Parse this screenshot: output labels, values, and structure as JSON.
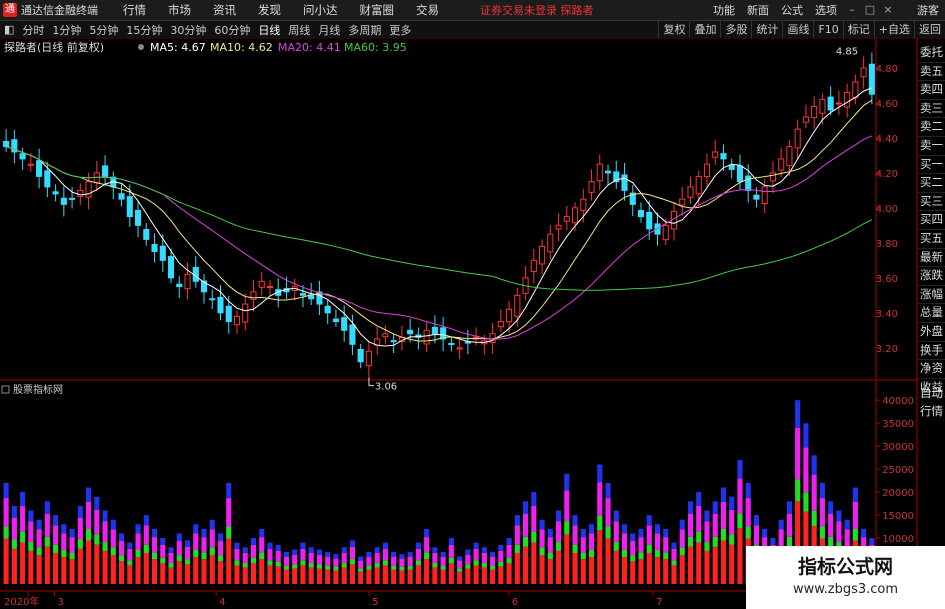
{
  "app": {
    "title": "通达信金融终端",
    "logo_char": "通"
  },
  "menu": [
    "行情",
    "市场",
    "资讯",
    "发现",
    "问小达",
    "财富圈",
    "交易"
  ],
  "notice": "证券交易未登录  探路者",
  "right_menu": [
    "功能",
    "新面",
    "公式",
    "选项",
    "游客"
  ],
  "toolbar": [
    "分时",
    "1分钟",
    "5分钟",
    "15分钟",
    "30分钟",
    "60分钟",
    "日线",
    "周线",
    "月线",
    "多周期",
    "更多"
  ],
  "toolbar_active": "日线",
  "toolbar_right": [
    "复权",
    "叠加",
    "多股",
    "统计",
    "画线",
    "F10",
    "标记",
    "+自选",
    "返回"
  ],
  "side_tabs": [
    "委托",
    "卖五",
    "卖四",
    "卖三",
    "卖二",
    "卖一",
    "买一",
    "买二",
    "买三",
    "买四",
    "买五",
    "最新",
    "涨跌",
    "涨幅",
    "总量",
    "外盘",
    "换手",
    "净资",
    "收益"
  ],
  "side_tabs2": [
    "自动",
    "行情"
  ],
  "main_legend": {
    "name": "探路者(日线 前复权)",
    "ma5": "MA5: 4.67",
    "ma10": "MA10: 4.62",
    "ma20": "MA20: 4.41",
    "ma60": "MA60: 3.95",
    "color_ma5": "#ffffff",
    "color_ma10": "#f0e68c",
    "color_ma20": "#dd44dd",
    "color_ma60": "#44cc44"
  },
  "volume_legend": "股票指标网",
  "annotations": {
    "high": "4.85",
    "low": "3.06"
  },
  "date_labels": [
    "2020年",
    "3",
    "4",
    "5",
    "6",
    "7"
  ],
  "watermark": {
    "title": "指标公式网",
    "url": "www.zbgs3.com"
  },
  "colors": {
    "up": "#ff3333",
    "down": "#33ddff",
    "axis": "#b00000",
    "ma5": "#ffffff",
    "ma10": "#f0e68c",
    "ma20": "#dd44dd",
    "ma60": "#44cc44"
  },
  "chart_data": [
    {
      "type": "candlestick",
      "title": "探路者(日线 前复权)",
      "y_ticks": [
        3.2,
        3.4,
        3.6,
        3.8,
        4.0,
        4.2,
        4.4,
        4.6,
        4.8
      ],
      "ylim": [
        3.05,
        4.88
      ],
      "close": [
        4.35,
        4.32,
        4.28,
        4.25,
        4.18,
        4.12,
        4.08,
        4.02,
        4.05,
        4.1,
        4.15,
        4.2,
        4.18,
        4.12,
        4.05,
        3.95,
        3.9,
        3.82,
        3.75,
        3.7,
        3.6,
        3.55,
        3.62,
        3.58,
        3.52,
        3.48,
        3.4,
        3.35,
        3.38,
        3.45,
        3.52,
        3.58,
        3.55,
        3.5,
        3.52,
        3.55,
        3.5,
        3.48,
        3.45,
        3.4,
        3.35,
        3.3,
        3.22,
        3.12,
        3.18,
        3.25,
        3.28,
        3.24,
        3.26,
        3.28,
        3.26,
        3.3,
        3.28,
        3.25,
        3.22,
        3.2,
        3.23,
        3.26,
        3.24,
        3.28,
        3.35,
        3.42,
        3.5,
        3.6,
        3.7,
        3.78,
        3.85,
        3.9,
        3.95,
        4.0,
        4.05,
        4.15,
        4.25,
        4.2,
        4.15,
        4.1,
        4.02,
        3.95,
        3.88,
        3.85,
        3.9,
        3.98,
        4.05,
        4.12,
        4.18,
        4.25,
        4.32,
        4.28,
        4.22,
        4.15,
        4.1,
        4.05,
        4.12,
        4.2,
        4.28,
        4.35,
        4.45,
        4.52,
        4.58,
        4.62,
        4.56,
        4.6,
        4.66,
        4.72,
        4.8,
        4.65
      ]
    },
    {
      "type": "bar",
      "title": "股票指标网",
      "y_ticks": [
        5000,
        10000,
        15000,
        20000,
        25000,
        30000,
        35000,
        40000
      ],
      "ylim": [
        0,
        42000
      ],
      "values": [
        22000,
        17000,
        20000,
        16000,
        14000,
        18000,
        15000,
        13000,
        12000,
        17000,
        21000,
        19000,
        16000,
        14000,
        11000,
        9000,
        13000,
        15000,
        12000,
        10000,
        8000,
        11000,
        9500,
        13000,
        12000,
        14000,
        11000,
        22000,
        9000,
        8000,
        10000,
        12000,
        9000,
        8500,
        7000,
        7500,
        9000,
        8000,
        7500,
        7000,
        6500,
        8000,
        9500,
        6000,
        7000,
        8000,
        9000,
        7000,
        6500,
        7000,
        9000,
        12000,
        8000,
        7000,
        10000,
        6000,
        7500,
        9000,
        8000,
        7000,
        8500,
        10000,
        15000,
        18000,
        20000,
        14000,
        12000,
        16000,
        24000,
        15000,
        12000,
        13000,
        26000,
        22000,
        16000,
        13000,
        11000,
        12000,
        15000,
        13000,
        12000,
        9000,
        14000,
        18000,
        20000,
        16000,
        18000,
        21000,
        19000,
        27000,
        22000,
        15000,
        12000,
        10000,
        14000,
        18000,
        40000,
        35000,
        28000,
        22000,
        18000,
        16000,
        14000,
        21000,
        12000,
        10000
      ],
      "date_labels": [
        "2020年",
        "3",
        "4",
        "5",
        "6",
        "7"
      ]
    }
  ]
}
